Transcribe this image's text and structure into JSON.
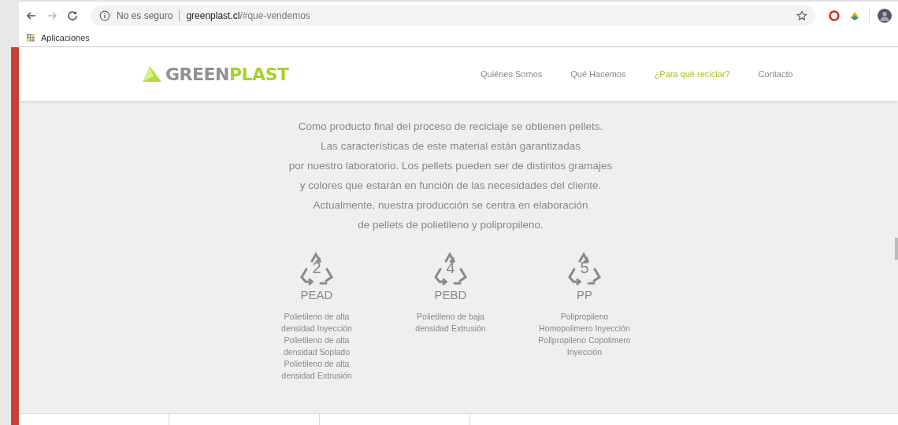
{
  "browser": {
    "security": "No es seguro",
    "url_host": "greenplast.cl",
    "url_path": "/#que-vendemos",
    "bookmarks": [
      {
        "label": "Aplicaciones"
      }
    ]
  },
  "site": {
    "logo": [
      "GREEN",
      "PLAST"
    ],
    "nav": [
      {
        "label": "Quiénes Somos",
        "selected": false
      },
      {
        "label": "Qué Hacemos",
        "selected": false
      },
      {
        "label": "¿Para qué reciclar?",
        "selected": true
      },
      {
        "label": "Contacto",
        "selected": false
      }
    ],
    "intro": [
      "Como producto final del proceso de reciclaje se obtienen pellets.",
      "Las características de este material están garantizadas",
      "por nuestro laboratorio. Los pellets pueden ser de distintos gramajes",
      "y colores que estarán en función de las necesidades del cliente.",
      "Actualmente, nuestra producción se centra en elaboración",
      "de pellets de polietileno y polipropileno."
    ],
    "plastics": [
      {
        "code": "2",
        "abbr": "PEAD",
        "lines": [
          "Polietileno de alta",
          "densidad Inyección",
          "Polietileno de alta",
          "densidad Soplado",
          "Polietileno de alta",
          "densidad Extrusión"
        ]
      },
      {
        "code": "4",
        "abbr": "PEBD",
        "lines": [
          "Polietileno de baja",
          "densidad Extrusión"
        ]
      },
      {
        "code": "5",
        "abbr": "PP",
        "lines": [
          "Polipropileno",
          "Homopolimero Inyección",
          "Polipropileno Copolimero",
          "Inyección"
        ]
      }
    ]
  }
}
